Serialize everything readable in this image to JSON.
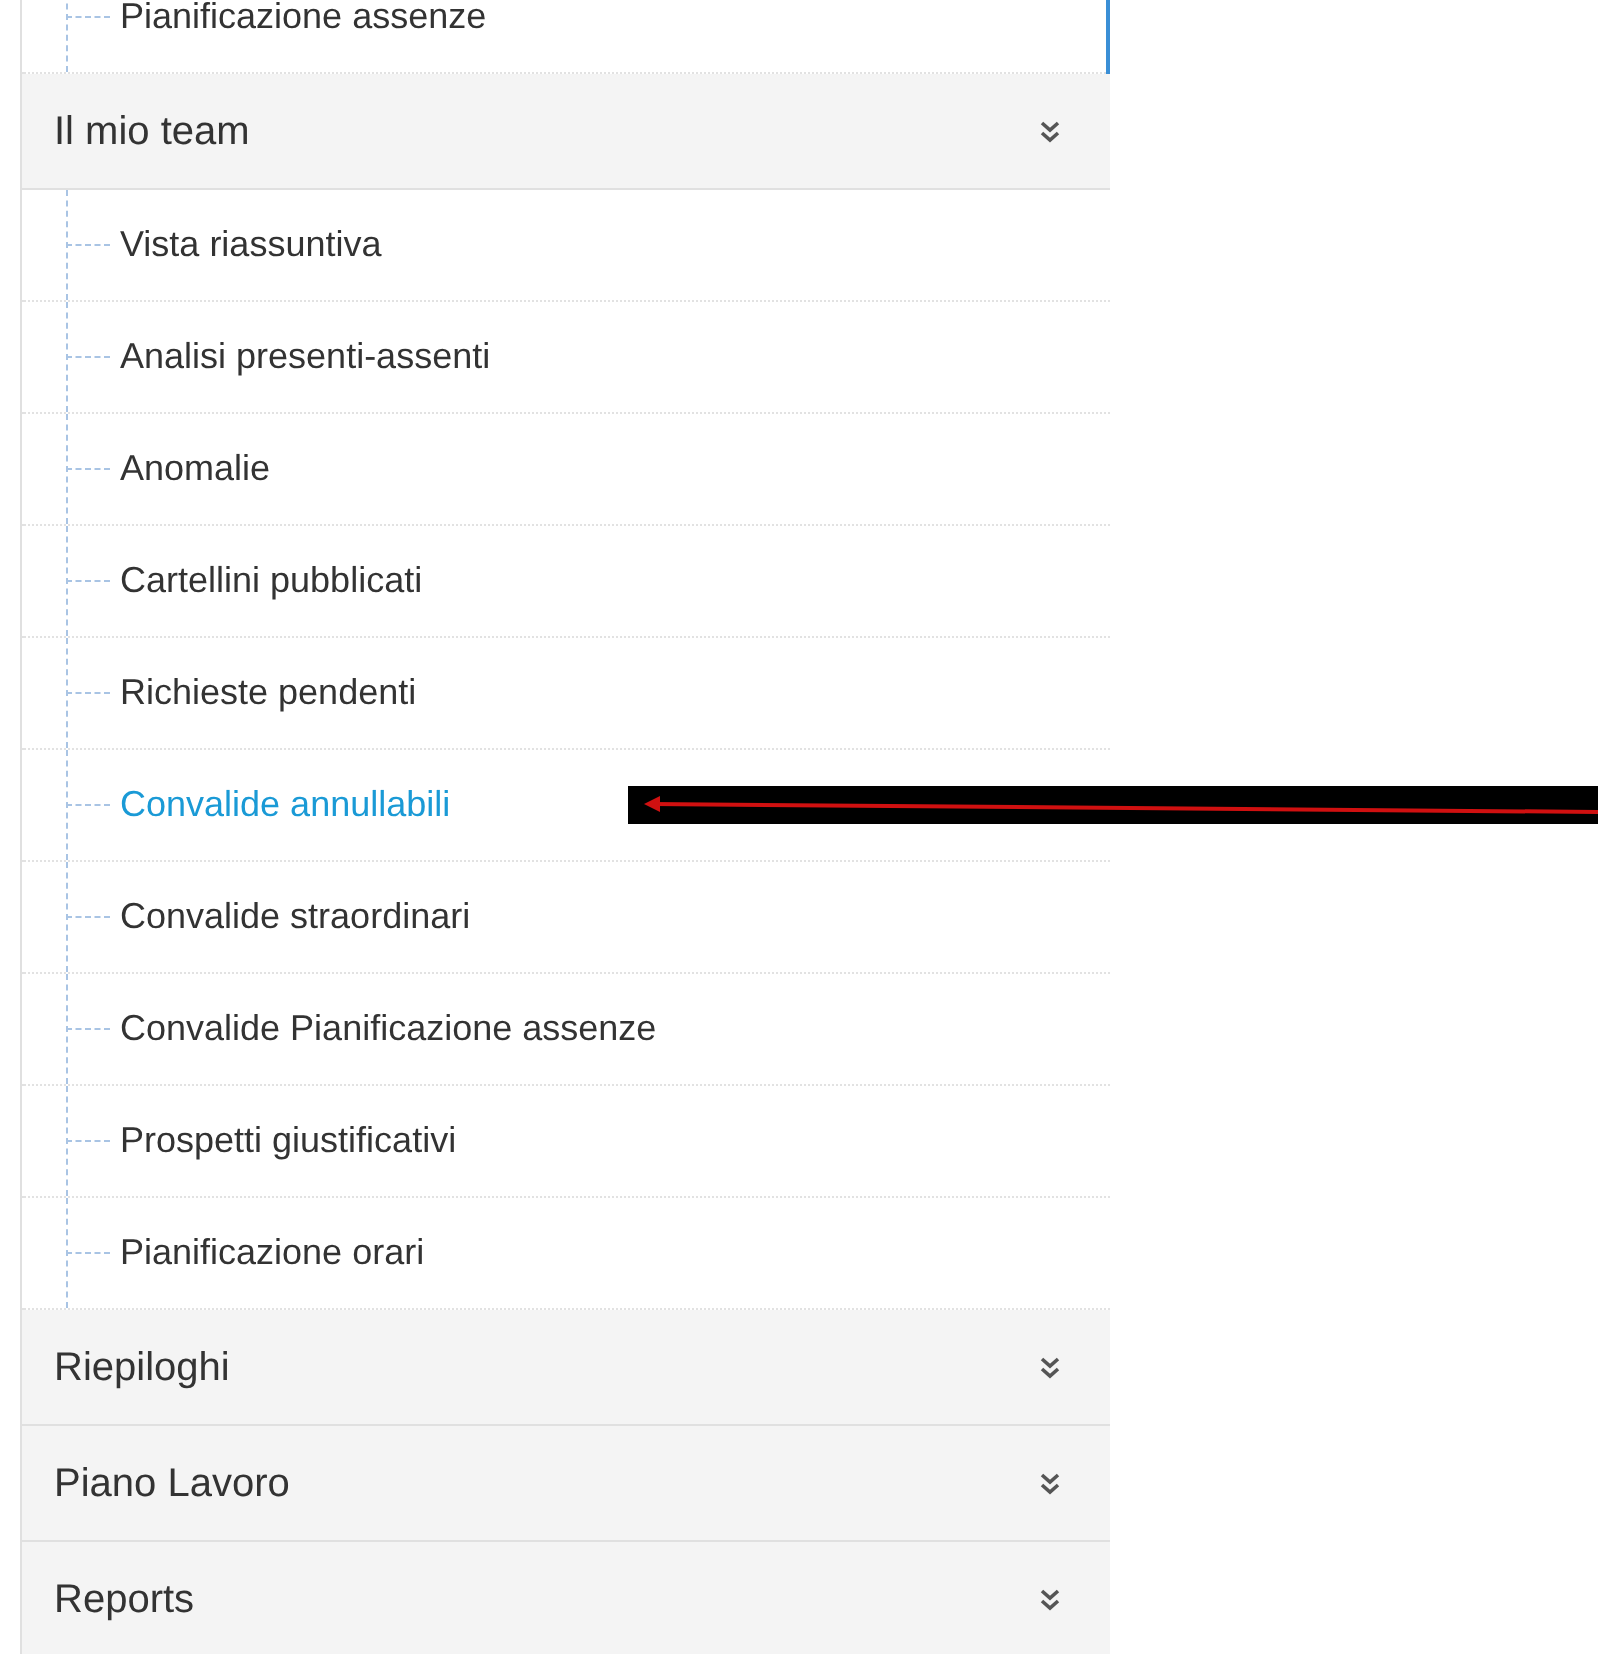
{
  "previous_items": [
    {
      "label": "Pianificazione assenze",
      "selected": false
    }
  ],
  "sections": [
    {
      "label": "Il mio team",
      "children": [
        {
          "label": "Vista riassuntiva",
          "selected": false
        },
        {
          "label": "Analisi presenti-assenti",
          "selected": false
        },
        {
          "label": "Anomalie",
          "selected": false
        },
        {
          "label": "Cartellini pubblicati",
          "selected": false
        },
        {
          "label": "Richieste pendenti",
          "selected": false
        },
        {
          "label": "Convalide annullabili",
          "selected": true
        },
        {
          "label": "Convalide straordinari",
          "selected": false
        },
        {
          "label": "Convalide Pianificazione assenze",
          "selected": false
        },
        {
          "label": "Prospetti giustificativi",
          "selected": false
        },
        {
          "label": "Pianificazione orari",
          "selected": false
        }
      ]
    },
    {
      "label": "Riepiloghi"
    },
    {
      "label": "Piano Lavoro"
    },
    {
      "label": "Reports"
    }
  ]
}
